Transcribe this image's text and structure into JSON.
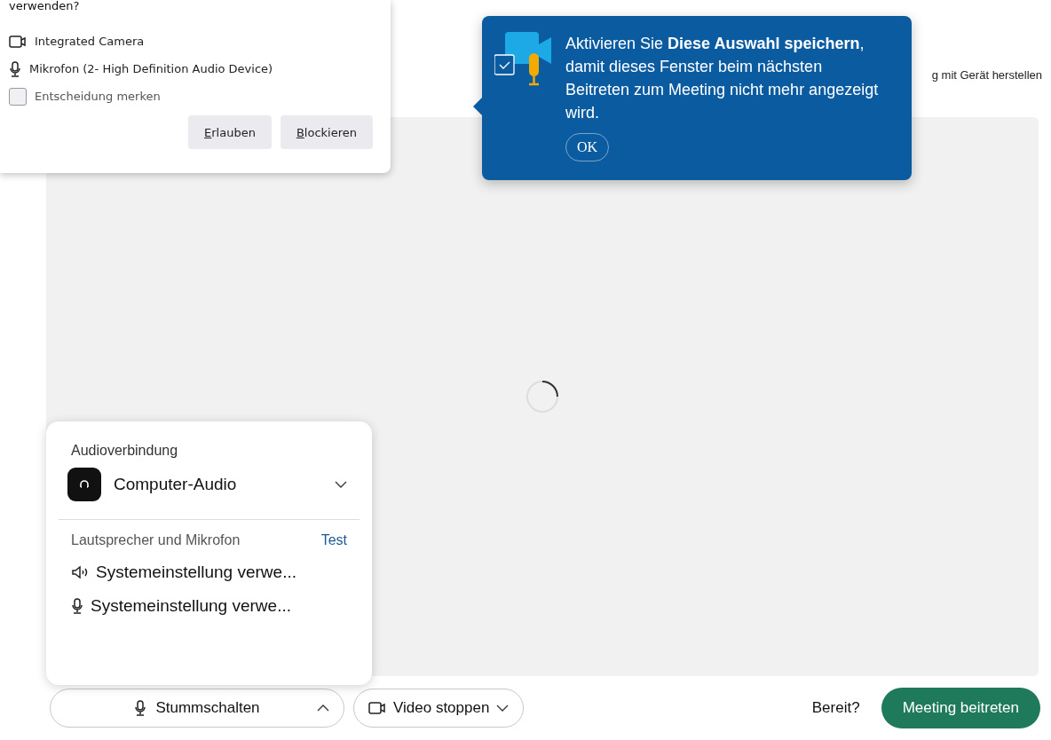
{
  "header_hint": "g mit Gerät herstellen",
  "permission_popup": {
    "title": "verwenden?",
    "devices": [
      {
        "kind": "camera",
        "label": "Integrated Camera"
      },
      {
        "kind": "microphone",
        "label": "Mikrofon (2- High Definition Audio Device)"
      }
    ],
    "remember": {
      "label": "Entscheidung merken",
      "checked": false
    },
    "buttons": [
      "Erlauben",
      "Blockieren"
    ]
  },
  "tooltip": {
    "text": "Aktivieren Sie **Diese Auswahl speichern**, damit dieses Fenster beim nächsten Beitreten zum Meeting nicht mehr angezeigt wird.",
    "button": "OK"
  },
  "audio_panel": {
    "title": "Audioverbindung",
    "connection": "Computer-Audio",
    "devices_label": "Lautsprecher und Mikrofon",
    "test_link": "Test",
    "devices": [
      {
        "kind": "speaker",
        "label": "Systemeinstellung verwe..."
      },
      {
        "kind": "microphone",
        "label": "Systemeinstellung verwe..."
      }
    ]
  },
  "bottom_bar": {
    "mute_button": {
      "label": "Stummschalten",
      "expanded": true
    },
    "video_button": "Video stoppen",
    "ready_label": "Bereit?",
    "join_button": "Meeting beitreten"
  }
}
